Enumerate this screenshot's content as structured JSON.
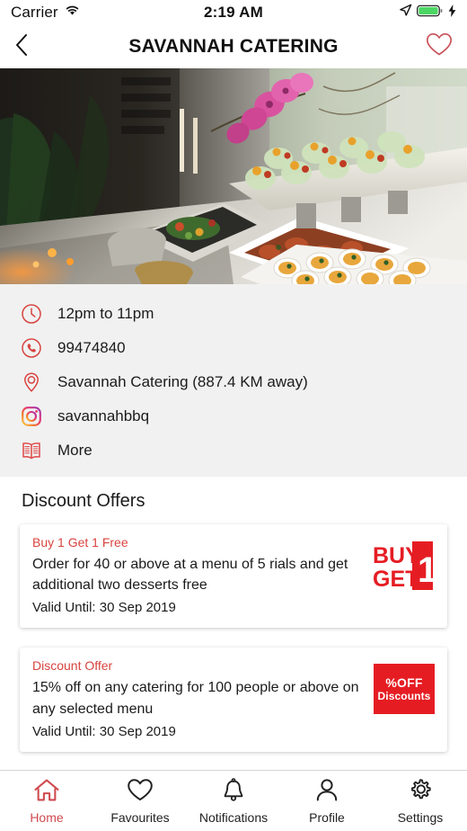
{
  "status_bar": {
    "carrier": "Carrier",
    "wifi_icon": "wifi-icon",
    "time": "2:19 AM",
    "location_icon": "location-arrow-icon",
    "battery_icon": "battery-icon",
    "charging_icon": "lightning-bolt-icon"
  },
  "nav": {
    "back_icon": "chevron-left-icon",
    "title": "SAVANNAH CATERING",
    "favourite_icon": "heart-outline-icon"
  },
  "hero": {
    "alt": "catering-buffet-photo"
  },
  "info": {
    "rows": [
      {
        "icon": "clock-icon",
        "text": "12pm to 11pm"
      },
      {
        "icon": "phone-icon",
        "text": "99474840"
      },
      {
        "icon": "map-pin-icon",
        "text": "Savannah Catering (887.4 KM away)"
      },
      {
        "icon": "instagram-icon",
        "text": "savannahbbq"
      },
      {
        "icon": "book-icon",
        "text": "More"
      }
    ]
  },
  "offers": {
    "title": "Discount Offers",
    "cards": [
      {
        "kicker": "Buy 1 Get 1 Free",
        "description": "Order for 40 or above at a menu of 5 rials and get additional two desserts free",
        "valid": "Valid Until:  30 Sep 2019",
        "badge_type": "bogo",
        "badge_line1": "BUY",
        "badge_line2": "GET",
        "badge_number": "1"
      },
      {
        "kicker": "Discount Offer",
        "description": "15% off on any catering for 100 people or above on any selected menu",
        "valid": "Valid Until:  30 Sep 2019",
        "badge_type": "off",
        "badge_line1": "%OFF",
        "badge_line2": "Discounts"
      }
    ]
  },
  "tabbar": {
    "items": [
      {
        "icon": "home-icon",
        "label": "Home",
        "active": true
      },
      {
        "icon": "heart-icon",
        "label": "Favourites",
        "active": false
      },
      {
        "icon": "bell-icon",
        "label": "Notifications",
        "active": false
      },
      {
        "icon": "person-icon",
        "label": "Profile",
        "active": false
      },
      {
        "icon": "gear-icon",
        "label": "Settings",
        "active": false
      }
    ]
  },
  "colors": {
    "accent_red": "#d8443f",
    "badge_red": "#e51d23",
    "tab_active": "#cf4a4f",
    "info_bg": "#f1f1f1",
    "battery_green": "#4cd764"
  }
}
